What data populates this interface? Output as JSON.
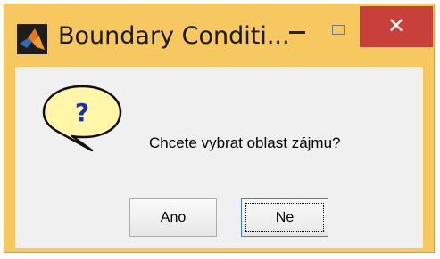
{
  "window": {
    "title": "Boundary Conditi...",
    "controls": {
      "minimize": "minimize",
      "maximize": "maximize",
      "close": "✕"
    }
  },
  "dialog": {
    "icon": "question-icon",
    "message": "Chcete vybrat oblast zájmu?",
    "buttons": [
      {
        "label": "Ano"
      },
      {
        "label": "Ne",
        "focused": true
      }
    ]
  },
  "colors": {
    "title_bar": "#f6c85f",
    "close_button": "#c7403a",
    "bubble_fill": "#fff6a8",
    "question_mark": "#1a2fb0"
  }
}
